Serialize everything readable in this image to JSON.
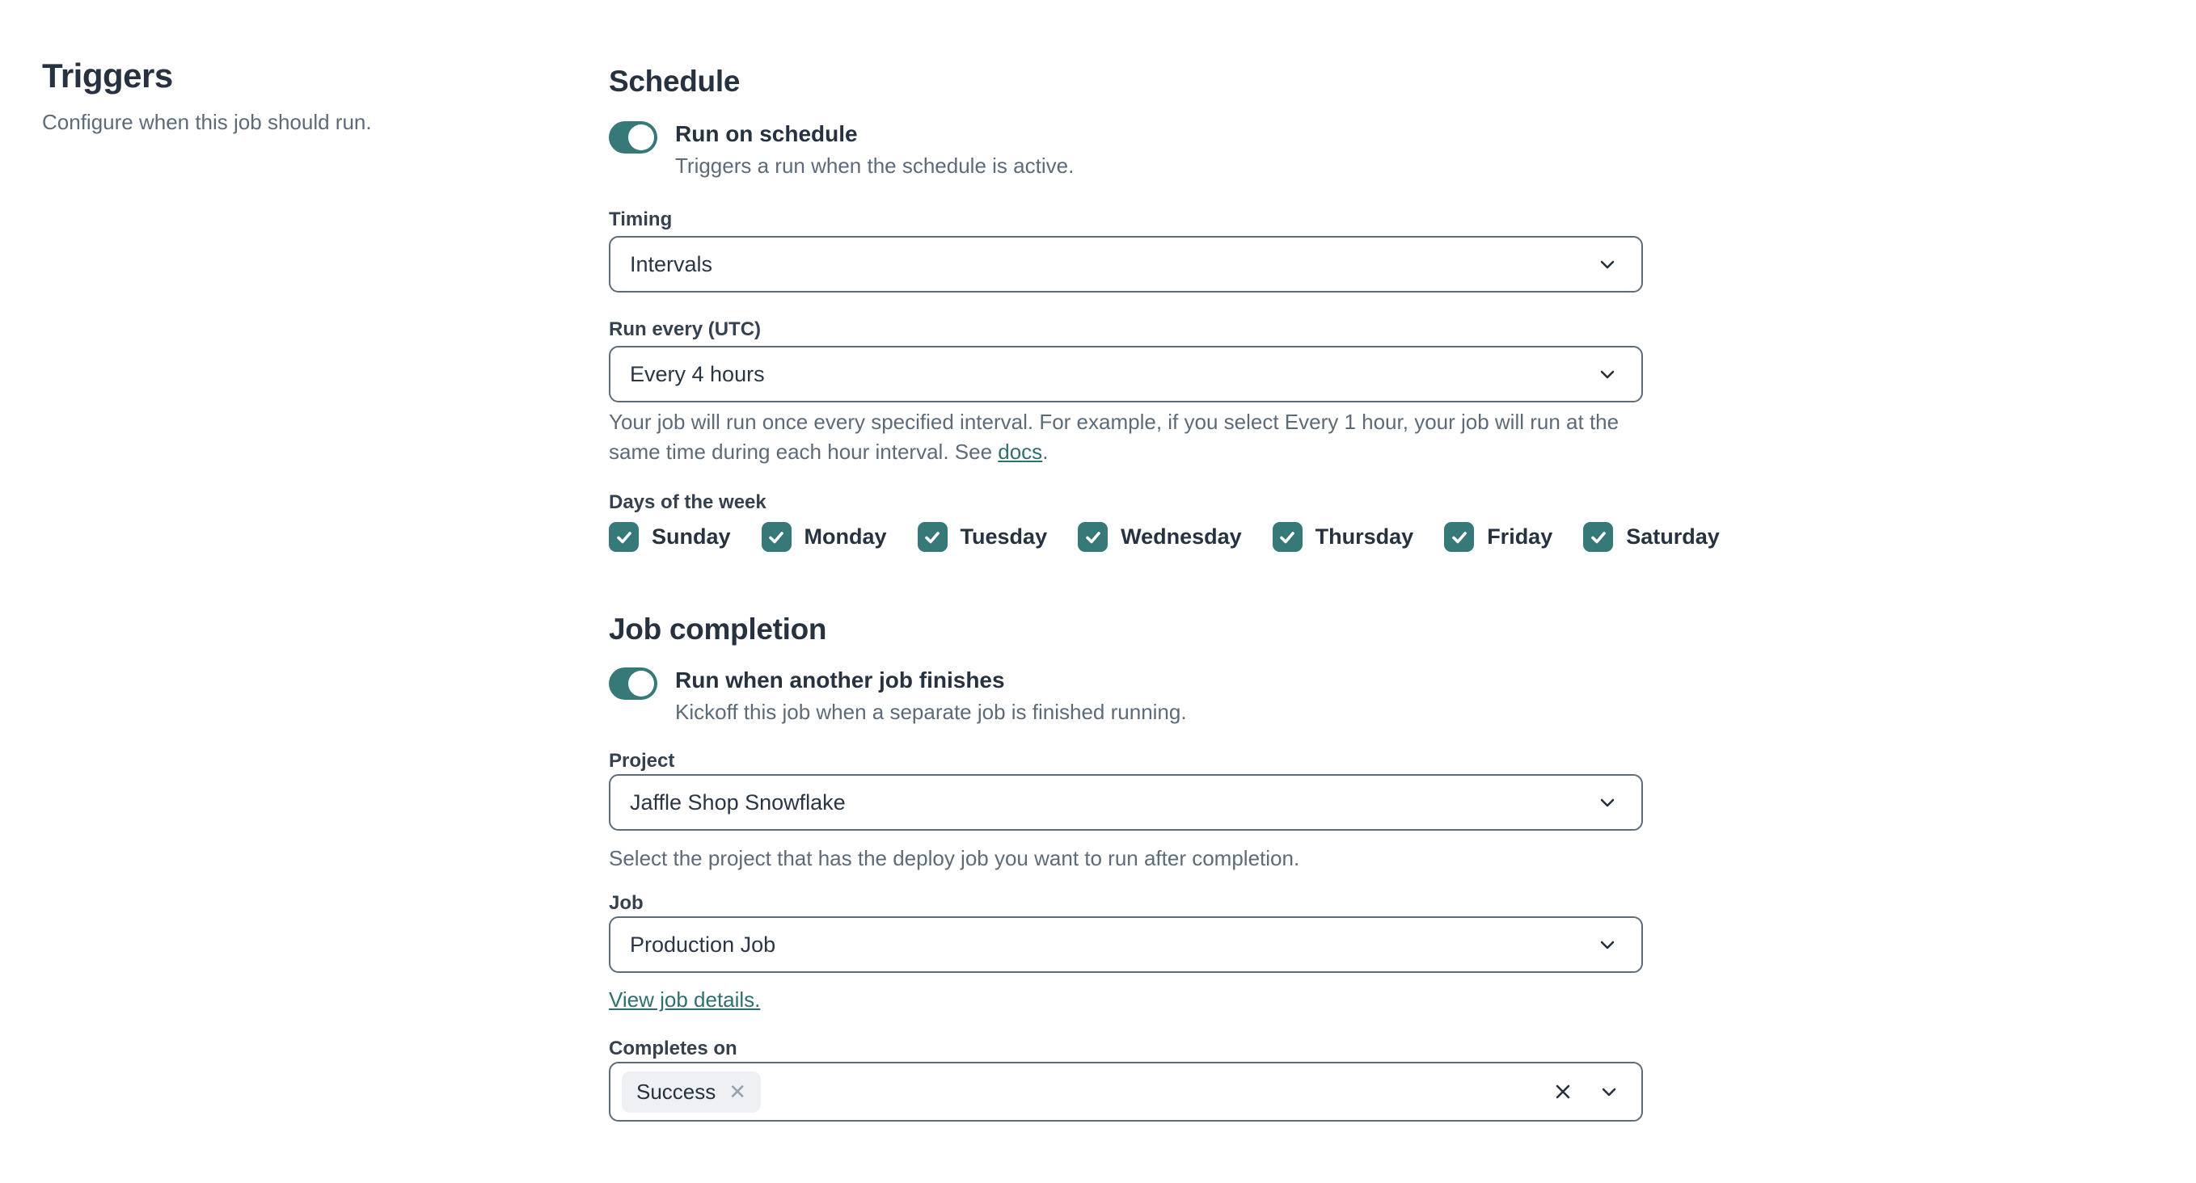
{
  "colors": {
    "accent_teal": "#377878",
    "link_teal": "#2f6f6f",
    "heading_text": "#26323f",
    "muted_text": "#5d6b79",
    "field_border": "#5f6b79",
    "chip_bg": "#eef0f3"
  },
  "sidebar": {
    "title": "Triggers",
    "subtitle": "Configure when this job should run."
  },
  "schedule": {
    "heading": "Schedule",
    "toggle": {
      "state": "on",
      "label": "Run on schedule",
      "description": "Triggers a run when the schedule is active."
    },
    "timing": {
      "label": "Timing",
      "value": "Intervals"
    },
    "run_every": {
      "label": "Run every (UTC)",
      "value": "Every 4 hours",
      "help_before": "Your job will run once every specified interval. For example, if you select Every 1 hour, your job will run at the same time during each hour interval. See ",
      "help_link": "docs",
      "help_after": "."
    },
    "days": {
      "label": "Days of the week",
      "items": [
        "Sunday",
        "Monday",
        "Tuesday",
        "Wednesday",
        "Thursday",
        "Friday",
        "Saturday"
      ],
      "checked": [
        true,
        true,
        true,
        true,
        true,
        true,
        true
      ]
    }
  },
  "job_completion": {
    "heading": "Job completion",
    "toggle": {
      "state": "on",
      "label": "Run when another job finishes",
      "description": "Kickoff this job when a separate job is finished running."
    },
    "project": {
      "label": "Project",
      "value": "Jaffle Shop Snowflake",
      "help": "Select the project that has the deploy job you want to run after completion."
    },
    "job": {
      "label": "Job",
      "value": "Production Job",
      "link": "View job details."
    },
    "completes_on": {
      "label": "Completes on",
      "chips": [
        {
          "label": "Success"
        }
      ]
    }
  }
}
